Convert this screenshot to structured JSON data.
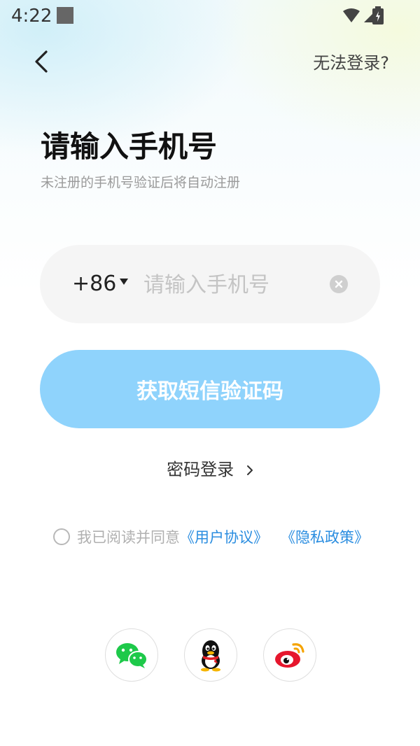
{
  "status_bar": {
    "time": "4:22"
  },
  "header": {
    "help_label": "无法登录?"
  },
  "title": "请输入手机号",
  "subtitle": "未注册的手机号验证后将自动注册",
  "phone": {
    "country_code": "+86",
    "placeholder": "请输入手机号",
    "value": ""
  },
  "sms_button_label": "获取短信验证码",
  "password_login_label": "密码登录",
  "agreement": {
    "prefix": "我已阅读并同意",
    "user_agreement": "《用户协议》",
    "privacy_policy": "《隐私政策》",
    "checked": false
  },
  "colors": {
    "primary_button": "#8fd3fc",
    "link": "#2a8de0",
    "wechat": "#1ec94a",
    "weibo": "#e6162d"
  },
  "social_logins": [
    {
      "name": "wechat",
      "icon": "wechat-icon"
    },
    {
      "name": "qq",
      "icon": "qq-icon"
    },
    {
      "name": "weibo",
      "icon": "weibo-icon"
    }
  ]
}
